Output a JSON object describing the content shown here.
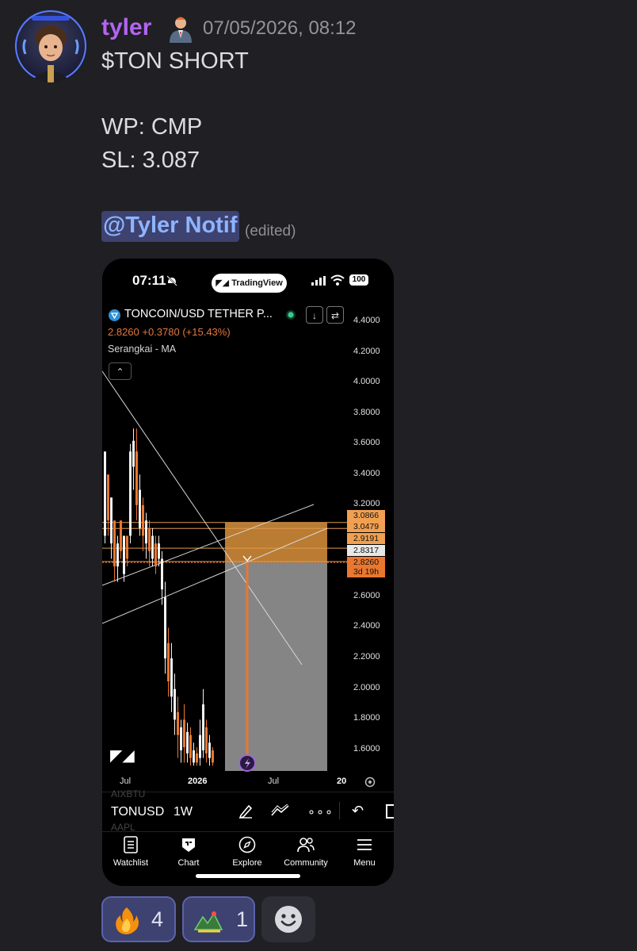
{
  "message": {
    "username": "tyler",
    "timestamp": "07/05/2026, 08:12",
    "line1": "$TON SHORT",
    "line2": "WP: CMP",
    "line3": "SL: 3.087",
    "mention": "@Tyler Notif",
    "edited": "(edited)"
  },
  "screenshot": {
    "status_time": "07:11",
    "app_pill": "TradingView",
    "battery": "100",
    "symbol": "TONCOIN/USD TETHER P...",
    "price_change": "2.8260  +0.3780 (+15.43%)",
    "indicator": "Serangkai - MA",
    "y_labels": [
      "4.4000",
      "4.2000",
      "4.0000",
      "3.8000",
      "3.6000",
      "3.4000",
      "3.2000",
      "2.6000",
      "2.4000",
      "2.2000",
      "2.0000",
      "1.8000",
      "1.6000"
    ],
    "price_tags": [
      {
        "value": "3.0866",
        "color": "#f0a050"
      },
      {
        "value": "3.0479",
        "color": "#f0a050"
      },
      {
        "value": "2.9191",
        "color": "#f0a050"
      },
      {
        "value": "2.8317",
        "color": "#e8e8e8"
      },
      {
        "value": "2.8260",
        "color": "#e9772f"
      },
      {
        "value": "3d 19h",
        "color": "#e9772f"
      }
    ],
    "x_labels": [
      "Jul",
      "2026",
      "Jul",
      "20"
    ],
    "ghost_tickers": [
      "AIXBTU",
      "AAPL"
    ],
    "ticker": "TONUSD",
    "interval": "1W",
    "nav": [
      "Watchlist",
      "Chart",
      "Explore",
      "Community",
      "Menu"
    ]
  },
  "chart_data": {
    "type": "candlestick",
    "title": "TONCOIN/USD TETHER P...",
    "timeframe": "1W",
    "ylim": [
      1.5,
      4.5
    ],
    "x_ticks": [
      "Jul",
      "2026",
      "Jul",
      "20"
    ],
    "current_price": 2.826,
    "levels": [
      3.0866,
      3.0479,
      2.9191,
      2.8317,
      2.826
    ],
    "short_position": {
      "entry": 2.826,
      "stop": 3.0866,
      "target_below": 1.5
    }
  },
  "reactions": [
    {
      "emoji": "fire-emoji",
      "count": "4"
    },
    {
      "emoji": "chart-emoji",
      "count": "1"
    }
  ],
  "colors": {
    "bg": "#1f1f24",
    "username": "#b364f0",
    "mention_bg": "#3d4270",
    "mention_text": "#8fb4ff",
    "stop_zone": "#c98736",
    "target_zone": "#8c8c8c",
    "accent": "#e9772f"
  }
}
